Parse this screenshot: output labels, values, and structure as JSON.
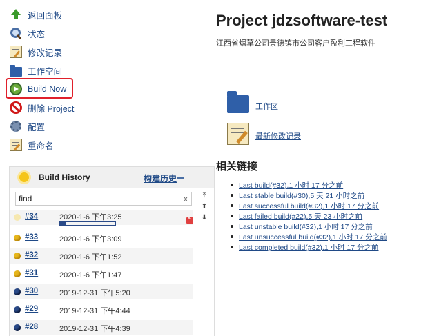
{
  "sidebar": {
    "items": [
      {
        "label": "返回面板",
        "icon": "up-arrow-icon"
      },
      {
        "label": "状态",
        "icon": "search-icon"
      },
      {
        "label": "修改记录",
        "icon": "notepad-icon"
      },
      {
        "label": "工作空间",
        "icon": "folder-icon"
      },
      {
        "label": "Build Now",
        "icon": "build-now-icon"
      },
      {
        "label": "删除 Project",
        "icon": "delete-icon"
      },
      {
        "label": "配置",
        "icon": "gear-icon"
      },
      {
        "label": "重命名",
        "icon": "notepad-icon"
      }
    ]
  },
  "build_history": {
    "title": "Build History",
    "trend_link": "构建历史",
    "search_value": "find",
    "clear_symbol": "x",
    "builds": [
      {
        "number": "#34",
        "date": "2020-1-6 下午3:25",
        "status": "running",
        "progress": 0.1
      },
      {
        "number": "#33",
        "date": "2020-1-6 下午3:09",
        "status": "unstable"
      },
      {
        "number": "#32",
        "date": "2020-1-6 下午1:52",
        "status": "unstable"
      },
      {
        "number": "#31",
        "date": "2020-1-6 下午1:47",
        "status": "unstable"
      },
      {
        "number": "#30",
        "date": "2019-12-31 下午5:20",
        "status": "success"
      },
      {
        "number": "#29",
        "date": "2019-12-31 下午4:44",
        "status": "success"
      },
      {
        "number": "#28",
        "date": "2019-12-31 下午4:39",
        "status": "success"
      }
    ]
  },
  "main": {
    "title": "Project jdzsoftware-test",
    "description": "江西省烟草公司景德镇市公司客户盈利工程软件",
    "workspace_link": "工作区",
    "changes_link": "最新修改记录",
    "related_title": "相关链接",
    "related_links": [
      "Last build(#32),1 小时 17 分之前",
      "Last stable build(#30),5 天 21 小时之前",
      "Last successful build(#32),1 小时 17 分之前",
      "Last failed build(#22),5 天 23 小时之前",
      "Last unstable build(#32),1 小时 17 分之前",
      "Last unsuccessful build(#32),1 小时 17 分之前",
      "Last completed build(#32),1 小时 17 分之前"
    ]
  },
  "colors": {
    "link": "#204a87",
    "highlight": "#e0202b"
  }
}
